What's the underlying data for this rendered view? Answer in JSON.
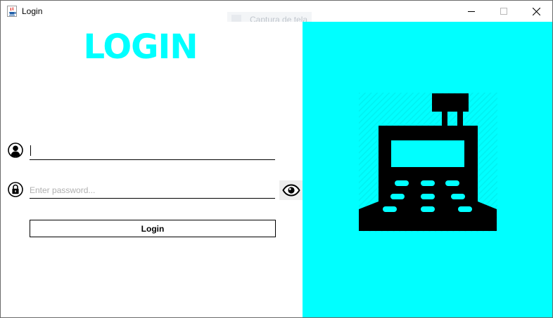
{
  "window": {
    "title": "Login",
    "app_icon": "java-cup-icon",
    "controls": {
      "minimize": "minimize-icon",
      "maximize": "maximize-icon",
      "close": "close-icon"
    }
  },
  "background_hint": {
    "text": "Captura de tela"
  },
  "form": {
    "heading": "LOGIN",
    "username": {
      "value": "",
      "icon": "user-icon"
    },
    "password": {
      "value": "",
      "placeholder": "Enter password...",
      "icon": "lock-icon",
      "toggle_icon": "eye-icon"
    },
    "login_button_label": "Login"
  },
  "illustration": {
    "icon": "cash-register-icon"
  },
  "colors": {
    "accent": "#00ffff",
    "ink": "#000000",
    "background": "#ffffff"
  }
}
